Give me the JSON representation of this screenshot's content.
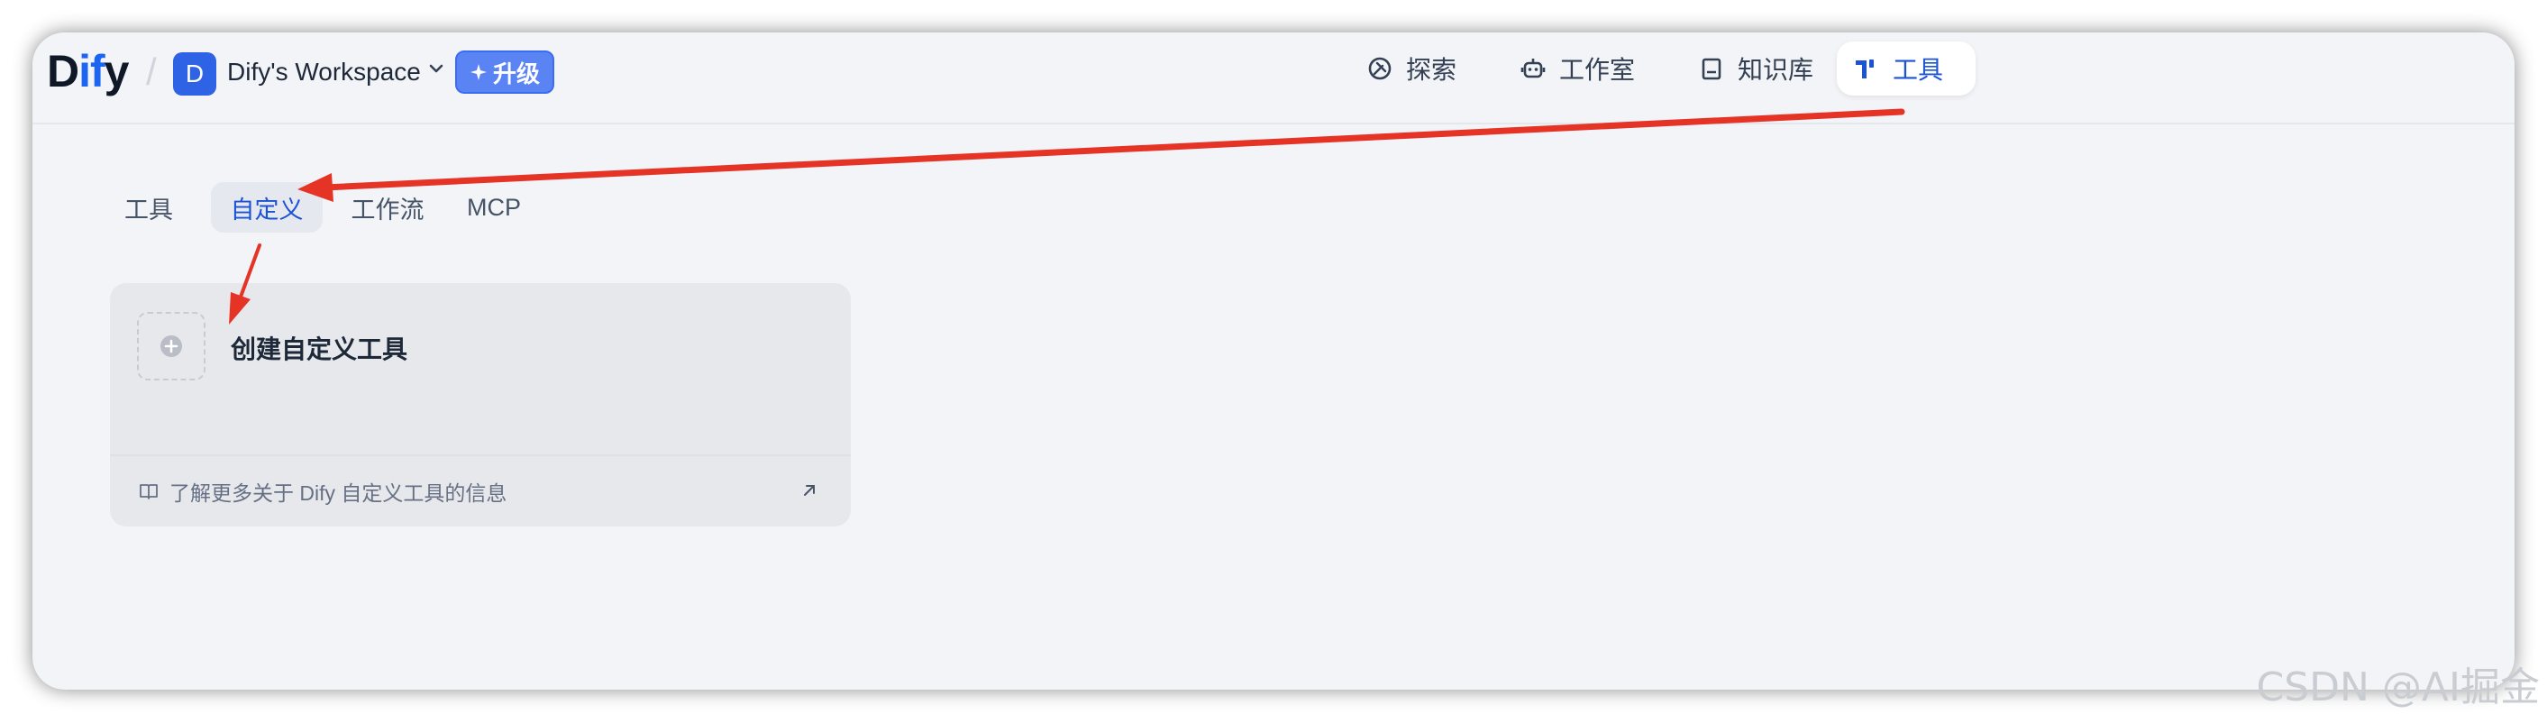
{
  "header": {
    "logo": {
      "prefix": "D",
      "accent": "if",
      "suffix": "y"
    },
    "workspace": {
      "avatar_letter": "D",
      "name": "Dify's Workspace"
    },
    "upgrade_label": "升级",
    "nav": [
      {
        "label": "探索",
        "icon": "compass-icon"
      },
      {
        "label": "工作室",
        "icon": "robot-icon"
      },
      {
        "label": "知识库",
        "icon": "book-icon"
      },
      {
        "label": "工具",
        "icon": "tools-icon",
        "active": true
      }
    ]
  },
  "tabs": [
    {
      "label": "工具"
    },
    {
      "label": "自定义",
      "active": true
    },
    {
      "label": "工作流"
    },
    {
      "label": "MCP"
    }
  ],
  "card": {
    "title": "创建自定义工具",
    "footer_link": "了解更多关于 Dify 自定义工具的信息"
  },
  "watermark": "CSDN @AI掘金",
  "colors": {
    "accent": "#1c53d6",
    "annotation": "#e53426",
    "brand": "#2f63e6"
  }
}
